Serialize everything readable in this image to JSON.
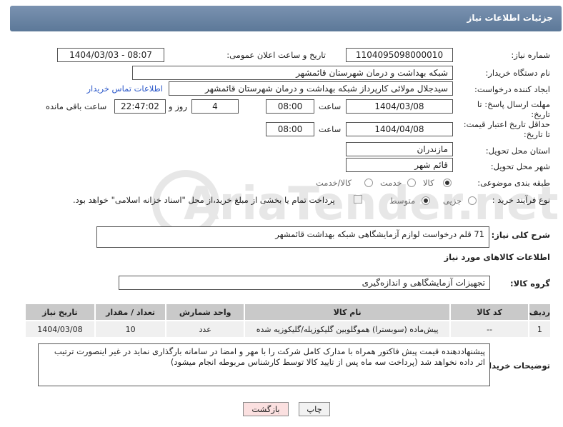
{
  "header": {
    "title": "جزئیات اطلاعات نیاز"
  },
  "fields": {
    "need_number_label": "شماره نیاز:",
    "need_number": "1104095098000010",
    "announce_label": "تاریخ و ساعت اعلان عمومی:",
    "announce_value": "1404/03/03 - 08:07",
    "buyer_org_label": "نام دستگاه خریدار:",
    "buyer_org": "شبکه بهداشت و درمان شهرستان قائمشهر",
    "requester_label": "ایجاد کننده درخواست:",
    "requester": "سیدجلال مولائی کارپرداز شبکه بهداشت و درمان شهرستان قائمشهر",
    "buyer_contact_link": "اطلاعات تماس خریدار",
    "reply_deadline_label_1": "مهلت ارسال پاسخ: تا",
    "reply_deadline_label_2": "تاریخ:",
    "reply_date": "1404/03/08",
    "time_label": "ساعت",
    "reply_time": "08:00",
    "days_value": "4",
    "days_label": "روز و",
    "remaining_time": "22:47:02",
    "remaining_label": "ساعت باقی مانده",
    "price_validity_label_1": "حداقل تاریخ اعتبار قیمت:",
    "price_validity_label_2": "تا تاریخ:",
    "validity_date": "1404/04/08",
    "validity_time": "08:00",
    "province_label": "استان محل تحویل:",
    "province": "مازندران",
    "city_label": "شهر محل تحویل:",
    "city": "قائم شهر",
    "category_label": "طبقه بندی موضوعی:",
    "category_options": [
      "کالا",
      "خدمت",
      "کالا/خدمت"
    ],
    "process_label": "نوع فرآیند خرید :",
    "process_options": [
      "جزیی",
      "متوسط"
    ],
    "payment_note": "پرداخت تمام یا بخشی از مبلغ خرید،از محل \"اسناد خزانه اسلامی\" خواهد بود.",
    "description_label": "شرح کلی نیاز:",
    "description": "71 قلم درخواست لوازم آزمایشگاهی شبکه بهداشت قائمشهر",
    "goods_info_title": "اطلاعات کالاهای مورد نیاز",
    "goods_group_label": "گروه کالا:",
    "goods_group": "تجهیزات آزمایشگاهی و اندازه‌گیری",
    "buyer_notes_label": "توضیحات خریدار:",
    "buyer_notes": "پیشنهاددهنده قیمت پیش فاکتور همراه با مدارک کامل شرکت را با مهر و امضا در سامانه بارگذاری نماید در غیر اینصورت ترتیب اثر داده نخواهد شد (پرداخت سه ماه پس از تایید کالا توسط کارشناس مربوطه انجام میشود)"
  },
  "table": {
    "headers": [
      "ردیف",
      "کد کالا",
      "نام کالا",
      "واحد شمارش",
      "تعداد / مقدار",
      "تاریخ نیاز"
    ],
    "rows": [
      [
        "1",
        "--",
        "پیش‌ماده (سوبسترا) هموگلوبین گلیکوزیله/گلیکوزیه شده",
        "عدد",
        "10",
        "1404/03/08"
      ]
    ]
  },
  "buttons": {
    "print": "چاپ",
    "back": "بازگشت"
  },
  "watermark_text": "AriaTender.net",
  "colors": {
    "header": "#6b84a4",
    "table_header": "#c9c9c9",
    "link": "#2a57c9",
    "back_button": "#fbe0e0"
  }
}
